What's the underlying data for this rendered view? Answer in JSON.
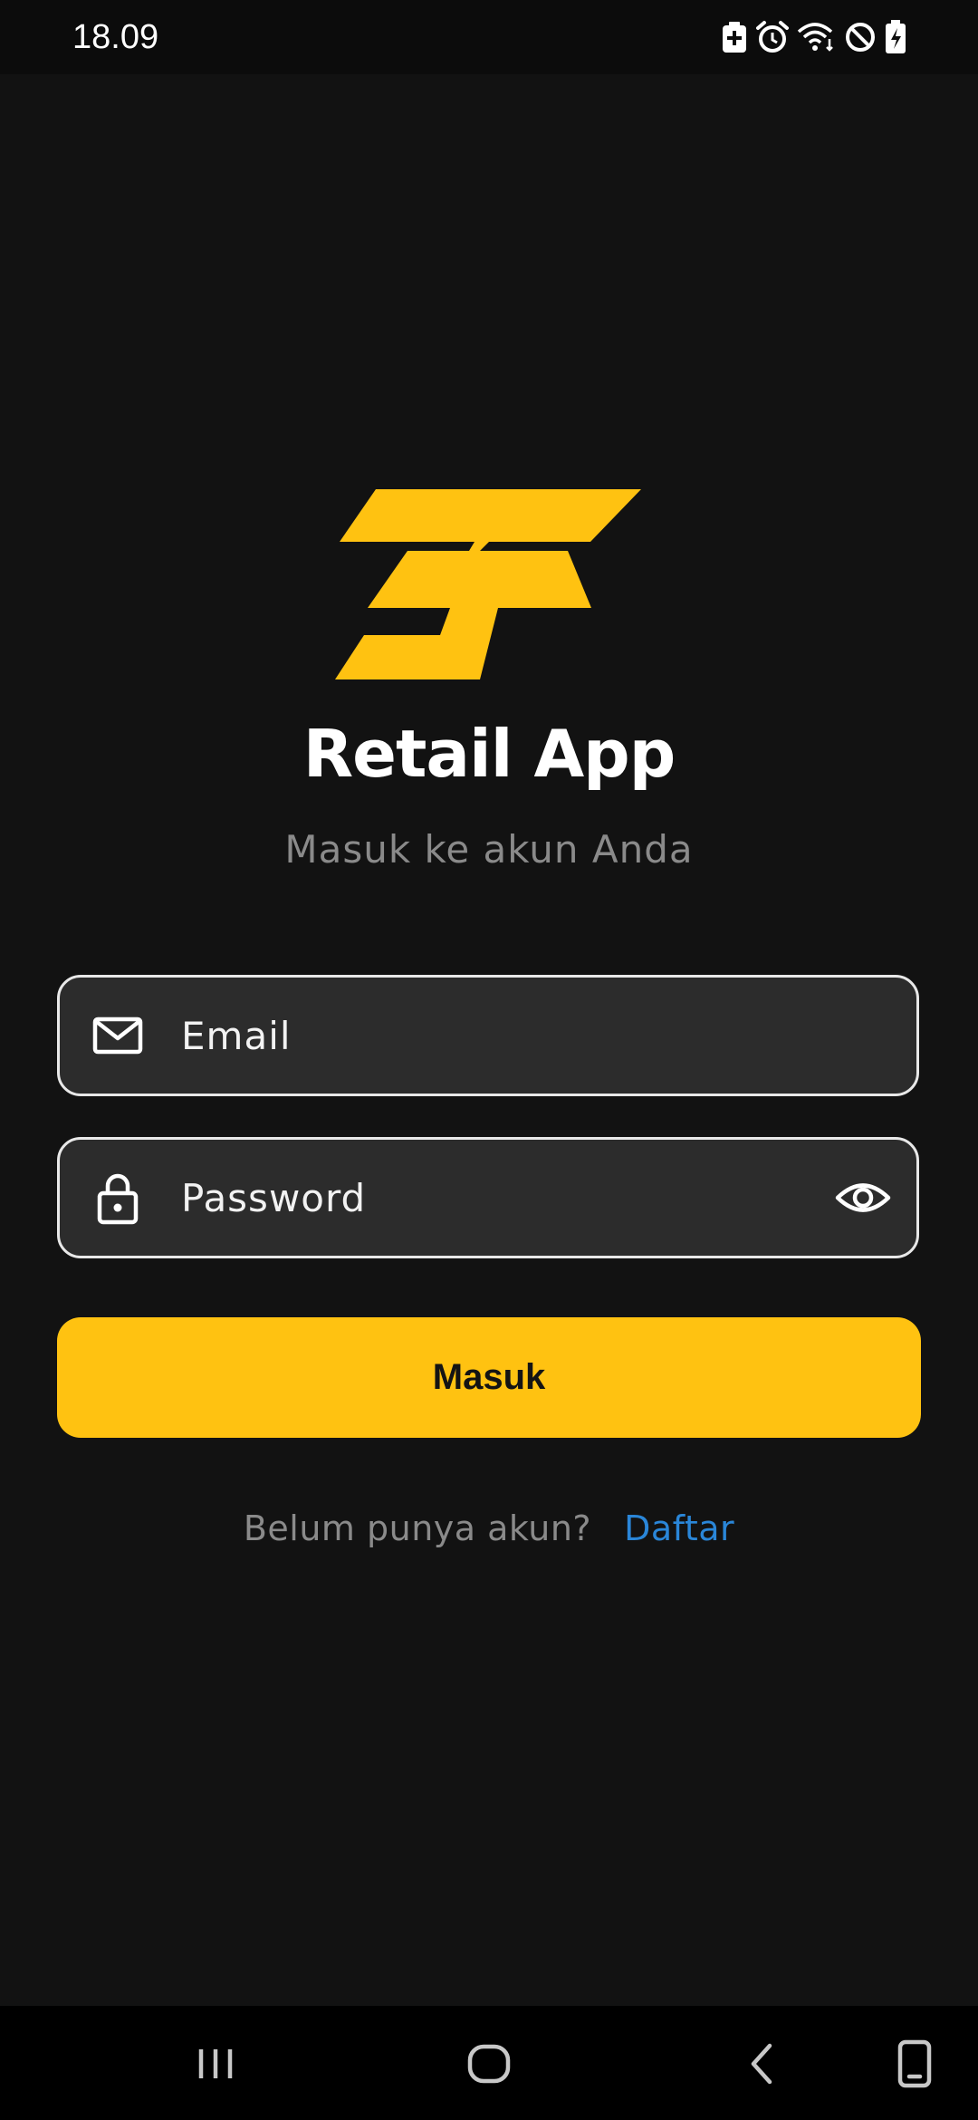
{
  "status_bar": {
    "time": "18.09",
    "icons": [
      "battery-saver-icon",
      "alarm-icon",
      "wifi-icon",
      "do-not-disturb-icon",
      "battery-charging-icon"
    ]
  },
  "colors": {
    "background": "#121212",
    "accent": "#ffc211",
    "link": "#2a86d8",
    "field_background": "#2c2c2c",
    "muted_text": "#8a8a8a"
  },
  "app": {
    "logo": "app-logo",
    "title": "Retail App",
    "subtitle": "Masuk ke akun Anda"
  },
  "form": {
    "email": {
      "icon": "mail-icon",
      "placeholder": "Email",
      "value": ""
    },
    "password": {
      "icon": "lock-icon",
      "placeholder": "Password",
      "value": "",
      "toggle_icon": "eye-icon"
    },
    "submit_label": "Masuk"
  },
  "register": {
    "prompt": "Belum punya akun?",
    "link_label": "Daftar"
  },
  "nav_bar": {
    "buttons": [
      "recents-icon",
      "home-icon",
      "back-icon",
      "keyboard-toggle-icon"
    ]
  }
}
